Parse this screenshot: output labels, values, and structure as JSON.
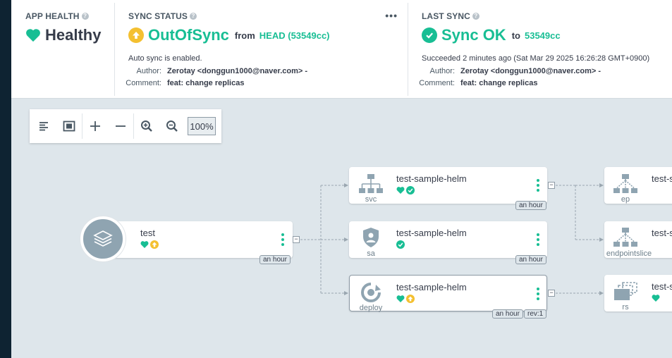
{
  "app_health": {
    "title": "APP HEALTH",
    "status": "Healthy"
  },
  "sync_status": {
    "title": "SYNC STATUS",
    "status": "OutOfSync",
    "from_label": "from",
    "revision": "HEAD (53549cc)",
    "auto_sync": "Auto sync is enabled.",
    "author_label": "Author:",
    "author": "Zerotay <donggun1000@naver.com> -",
    "comment_label": "Comment:",
    "comment": "feat: change replicas",
    "menu": "•••"
  },
  "last_sync": {
    "title": "LAST SYNC",
    "status": "Sync OK",
    "to_label": "to",
    "revision": "53549cc",
    "succeeded": "Succeeded 2 minutes ago (Sat Mar 29 2025 16:26:28 GMT+0900)",
    "author_label": "Author:",
    "author": "Zerotay <donggun1000@naver.com> -",
    "comment_label": "Comment:",
    "comment": "feat: change replicas"
  },
  "toolbar": {
    "zoom": "100%"
  },
  "graph": {
    "app_node": {
      "name": "test",
      "age": "an hour",
      "collapse": "−"
    },
    "svc_node": {
      "name": "test-sample-helm",
      "kind": "svc",
      "age": "an hour",
      "collapse": "−"
    },
    "sa_node": {
      "name": "test-sample-helm",
      "kind": "sa",
      "age": "an hour"
    },
    "deploy_node": {
      "name": "test-sample-helm",
      "kind": "deploy",
      "age": "an hour",
      "rev": "rev:1",
      "collapse": "−"
    },
    "ep_node": {
      "name": "test-s",
      "kind": "ep"
    },
    "endpointslice_node": {
      "name": "test-s",
      "kind": "endpointslice"
    },
    "rs_node": {
      "name": "test-s",
      "kind": "rs"
    }
  },
  "colors": {
    "synced_green": "#18be94",
    "outofsync_yellow": "#f4c030",
    "dark_text": "#363c4a",
    "sidebar": "#0e2332",
    "canvas": "#dee6eb"
  }
}
